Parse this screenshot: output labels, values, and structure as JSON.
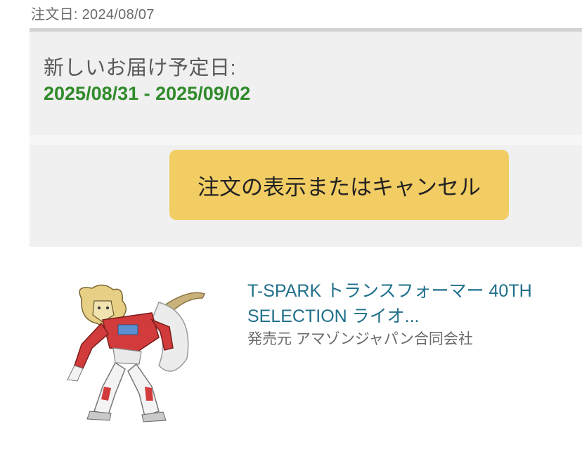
{
  "order": {
    "date_label": "注文日: 2024/08/07"
  },
  "delivery": {
    "label": "新しいお届け予定日:",
    "range": "2025/08/31 - 2025/09/02"
  },
  "actions": {
    "view_or_cancel_label": "注文の表示またはキャンセル"
  },
  "product": {
    "title": "T-SPARK トランスフォーマー 40TH SELECTION ライオ...",
    "seller": "発売元 アマゾンジャパン合同会社",
    "image_icon": "transformer-robot-figure-image"
  },
  "colors": {
    "delivery_green": "#2f8a2a",
    "button_yellow": "#f2cd64",
    "link_teal": "#1f6f8b"
  }
}
